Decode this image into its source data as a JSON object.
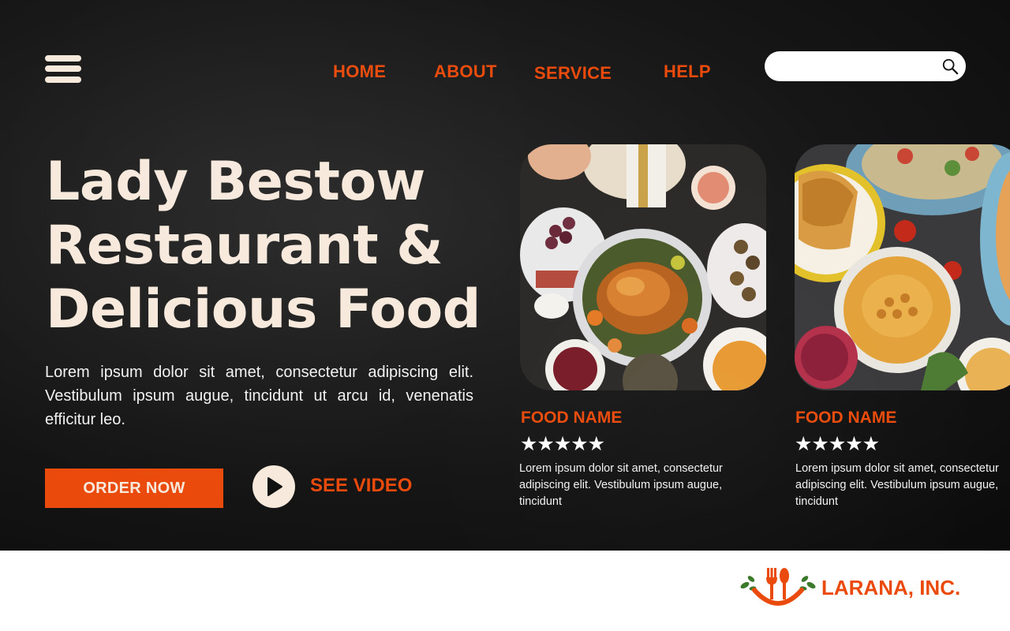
{
  "nav": {
    "links": [
      {
        "label": "HOME"
      },
      {
        "label": "ABOUT"
      },
      {
        "label": "SERVICE"
      },
      {
        "label": "HELP"
      }
    ],
    "search": {
      "placeholder": "",
      "value": ""
    }
  },
  "hero": {
    "title_lines": [
      "Lady Bestow",
      "Restaurant &",
      "Delicious Food"
    ],
    "description": "Lorem ipsum dolor sit amet, consectetur adipiscing elit. Vestibulum ipsum augue, tincidunt ut arcu id, venenatis efficitur leo.",
    "order_label": "ORDER NOW",
    "video_label": "SEE VIDEO"
  },
  "cards": [
    {
      "name": "FOOD NAME",
      "stars": "★★★★★",
      "description": "Lorem ipsum dolor sit amet, consectetur adipiscing elit. Vestibulum ipsum augue, tincidunt"
    },
    {
      "name": "FOOD NAME",
      "stars": "★★★★★",
      "description": "Lorem ipsum dolor sit amet, consectetur adipiscing elit. Vestibulum ipsum augue, tincidunt"
    }
  ],
  "footer": {
    "brand": "LARANA, INC."
  },
  "colors": {
    "accent": "#ea4b0c",
    "cream": "#f7e9dc",
    "background": "#141414",
    "logo_leaf": "#3a7a2a"
  },
  "icons": [
    "menu-icon",
    "search-icon",
    "play-icon",
    "fork-spoon-smile-logo"
  ]
}
